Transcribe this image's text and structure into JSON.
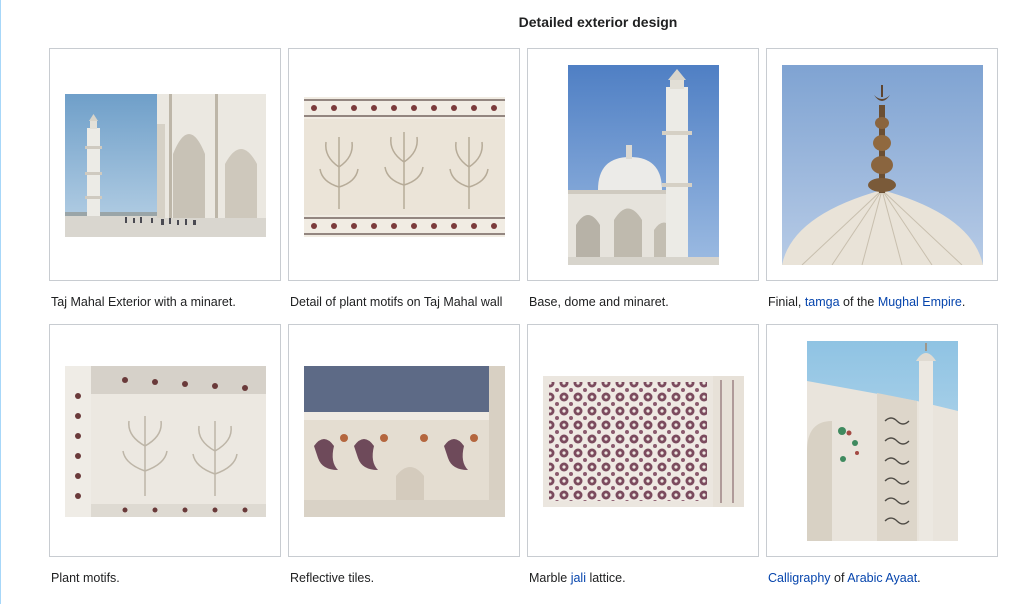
{
  "gallery": {
    "title": "Detailed exterior design",
    "items": [
      {
        "name": "exterior-minaret",
        "alt": "Taj Mahal Exterior with a minaret",
        "caption": [
          {
            "t": "Taj Mahal Exterior with a minaret."
          }
        ]
      },
      {
        "name": "plant-motifs-wall",
        "alt": "Detail of plant motifs on Taj Mahal wall",
        "caption": [
          {
            "t": "Detail of plant motifs on Taj Mahal wall"
          }
        ]
      },
      {
        "name": "base-dome-minaret",
        "alt": "Base, dome and minaret",
        "caption": [
          {
            "t": "Base, dome and minaret."
          }
        ]
      },
      {
        "name": "finial",
        "alt": "Finial",
        "caption": [
          {
            "t": "Finial, "
          },
          {
            "t": "tamga",
            "link": true
          },
          {
            "t": " of the "
          },
          {
            "t": "Mughal Empire",
            "link": true
          },
          {
            "t": "."
          }
        ]
      },
      {
        "name": "plant-motifs",
        "alt": "Plant motifs",
        "caption": [
          {
            "t": "Plant motifs."
          }
        ]
      },
      {
        "name": "reflective-tiles",
        "alt": "Reflective tiles",
        "caption": [
          {
            "t": "Reflective tiles."
          }
        ]
      },
      {
        "name": "jali-lattice",
        "alt": "Marble jali lattice",
        "caption": [
          {
            "t": "Marble "
          },
          {
            "t": "jali",
            "link": true
          },
          {
            "t": " lattice."
          }
        ]
      },
      {
        "name": "calligraphy",
        "alt": "Calligraphy of Arabic Ayaat",
        "caption": [
          {
            "t": "Calligraphy",
            "link": true
          },
          {
            "t": " of "
          },
          {
            "t": "Arabic Ayaat",
            "link": true
          },
          {
            "t": "."
          }
        ]
      }
    ]
  }
}
